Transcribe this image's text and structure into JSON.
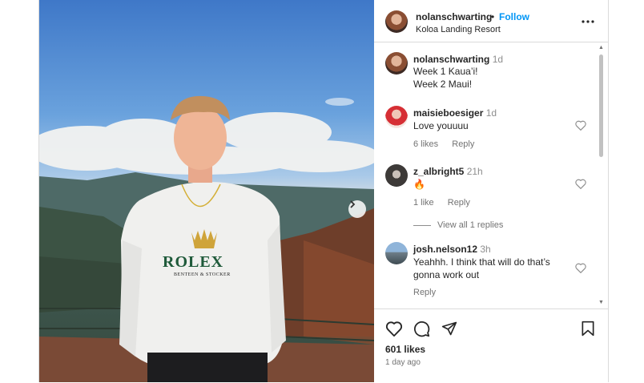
{
  "post": {
    "author": "nolanschwarting",
    "follow_label": "Follow",
    "separator": "•",
    "location": "Koloa Landing Resort",
    "photo_shirt_text": "ROLEX",
    "photo_shirt_sub": "BENTEEN & STOCKER"
  },
  "comments": [
    {
      "username": "nolanschwarting",
      "time": "1d",
      "lines": [
        "Week 1 Kaua’i!",
        "Week 2 Maui!"
      ]
    },
    {
      "username": "maisieboesiger",
      "time": "1d",
      "text": "Love youuuu",
      "likes": "6 likes",
      "reply": "Reply"
    },
    {
      "username": "z_albright5",
      "time": "21h",
      "text": "🔥",
      "likes": "1 like",
      "reply": "Reply",
      "view_replies": "View all 1 replies"
    },
    {
      "username": "josh.nelson12",
      "time": "3h",
      "lines": [
        "Yeahhh. I think that will do that’s",
        "gonna work out"
      ],
      "reply": "Reply"
    }
  ],
  "actions": {
    "likes": "601 likes",
    "time_ago": "1 day ago",
    "icons": [
      "heart-icon",
      "comment-icon",
      "share-icon",
      "bookmark-icon"
    ]
  },
  "colors": {
    "link_blue": "#0095f6",
    "border": "#dbdbdb",
    "muted": "#737373"
  }
}
